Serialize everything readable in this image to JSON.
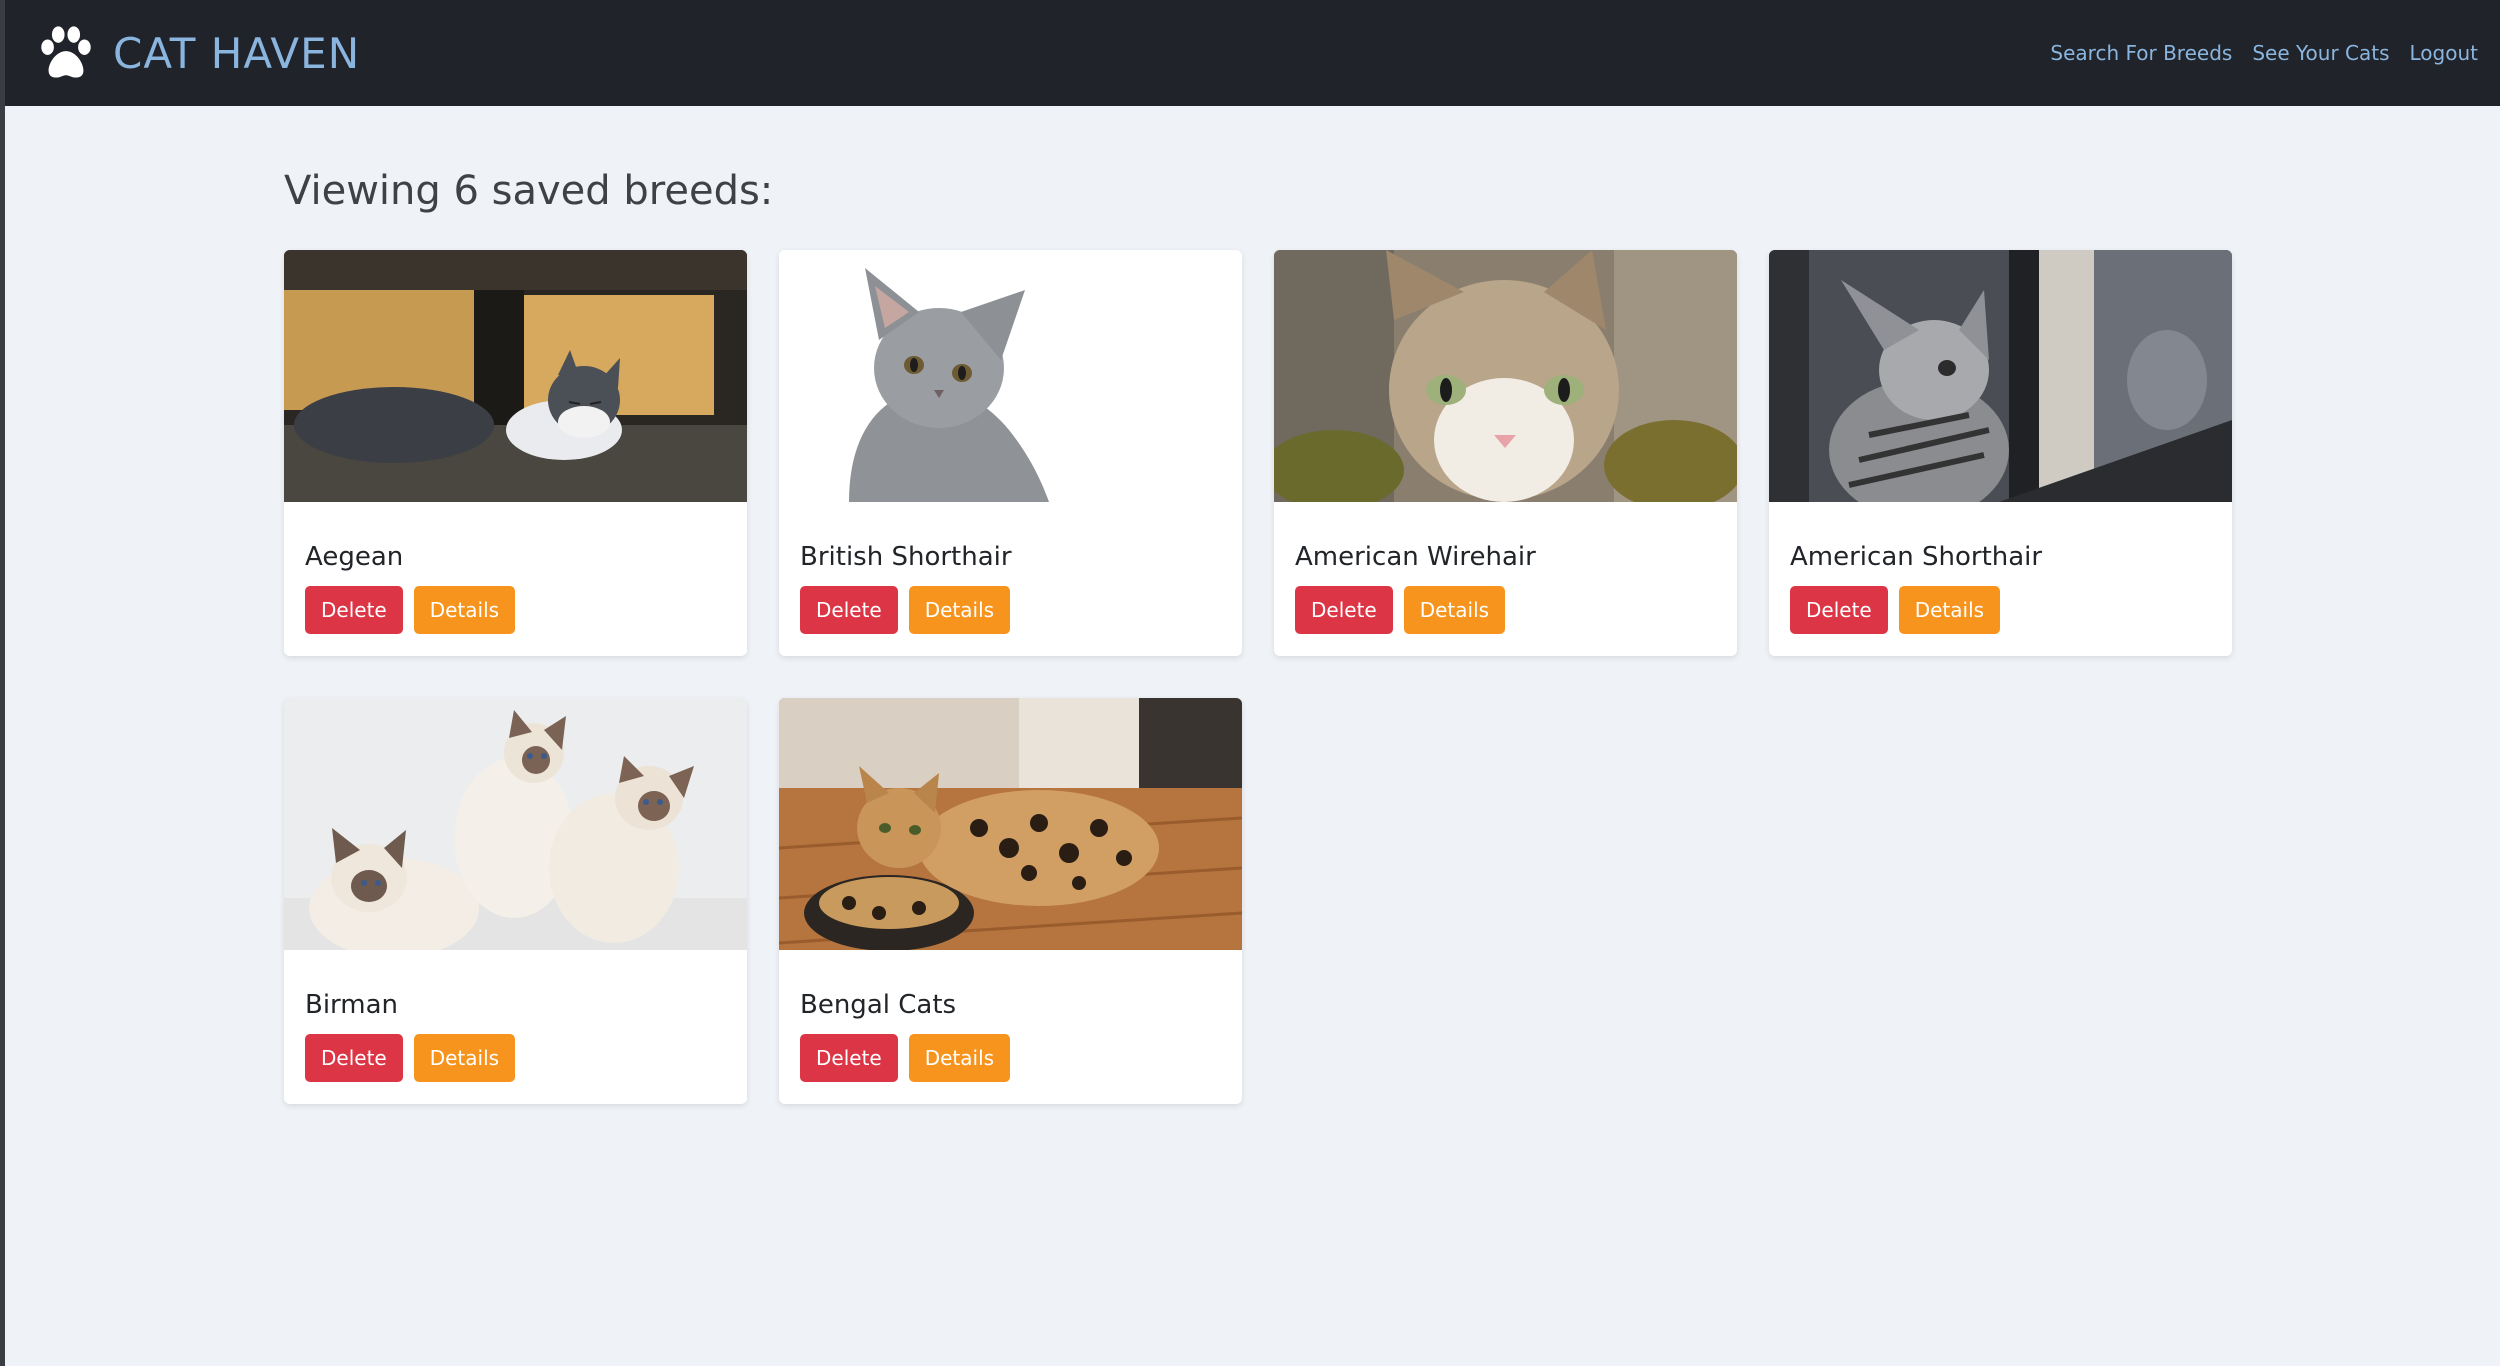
{
  "app": {
    "brand_title": "CAT HAVEN",
    "brand_icon": "paw-icon",
    "accent_color": "#8ab5df",
    "navbar_color": "#20242a"
  },
  "nav": {
    "links": [
      {
        "label": "Search For Breeds"
      },
      {
        "label": "See Your Cats"
      },
      {
        "label": "Logout"
      }
    ]
  },
  "main": {
    "heading": "Viewing 6 saved breeds:",
    "cards": [
      {
        "title": "Aegean",
        "image": "grey-white-cat-lying-on-ledge",
        "delete_label": "Delete",
        "details_label": "Details"
      },
      {
        "title": "British Shorthair",
        "image": "grey-kitten-on-white",
        "delete_label": "Delete",
        "details_label": "Details"
      },
      {
        "title": "American Wirehair",
        "image": "tabby-white-cat-face",
        "delete_label": "Delete",
        "details_label": "Details"
      },
      {
        "title": "American Shorthair",
        "image": "tabby-kitten-at-window",
        "delete_label": "Delete",
        "details_label": "Details"
      },
      {
        "title": "Birman",
        "image": "three-birman-kittens",
        "delete_label": "Delete",
        "details_label": "Details"
      },
      {
        "title": "Bengal Cats",
        "image": "bengal-cat-on-bed",
        "delete_label": "Delete",
        "details_label": "Details"
      }
    ]
  },
  "colors": {
    "delete": "#dc3545",
    "details": "#f7941d"
  }
}
